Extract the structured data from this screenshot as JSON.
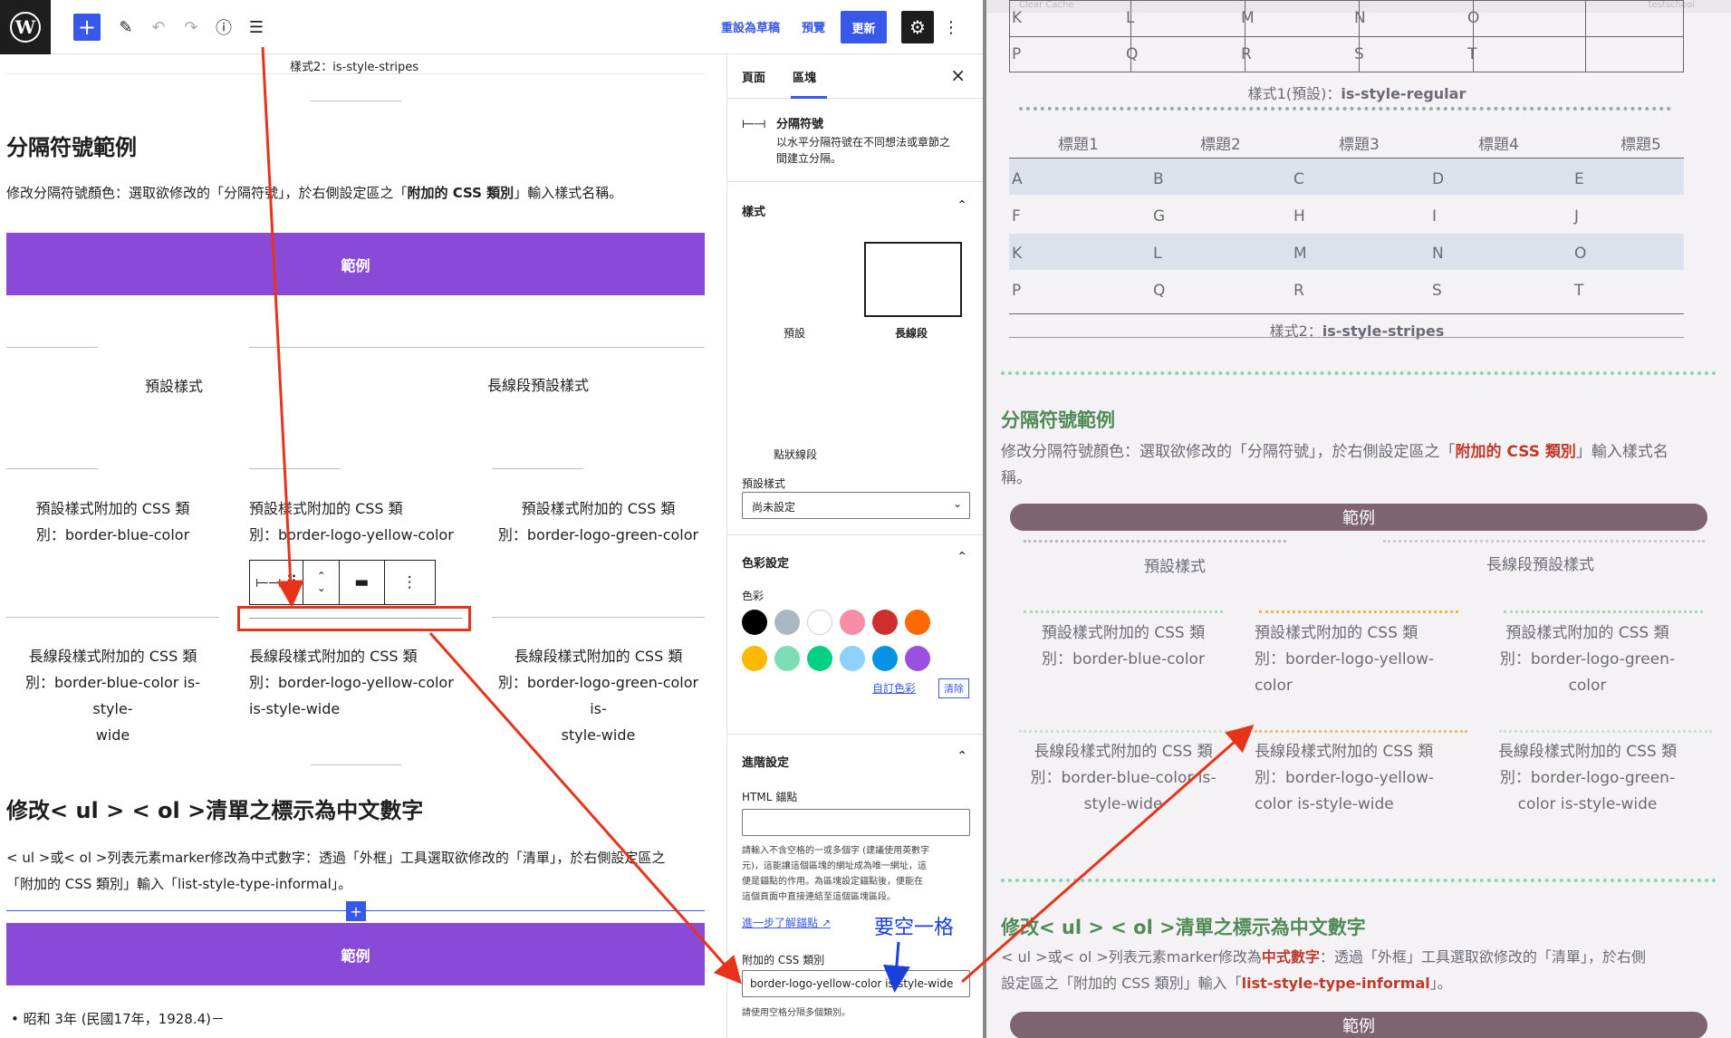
{
  "toolbar": {
    "revert_label": "重設為草稿",
    "preview_label": "預覽",
    "update_label": "更新",
    "logo_letter": "W"
  },
  "editor": {
    "caption_top": "樣式2：is-style-stripes",
    "heading1": "分隔符號範例",
    "para1_a": "修改分隔符號顏色：選取欲修改的「分隔符號」，於右側設定區之「",
    "para1_b": "附加的 CSS 類別",
    "para1_c": "」輸入樣式名稱。",
    "button1": "範例",
    "col_default": "預設樣式",
    "col_wide": "長線段預設樣式",
    "r1c1": [
      "預設樣式附加的 CSS 類",
      "別：border-blue-color"
    ],
    "r1c2": [
      "預設樣式附加的 CSS 類",
      "別：border-logo-yellow-color"
    ],
    "r1c3": [
      "預設樣式附加的 CSS 類",
      "別：border-logo-green-color"
    ],
    "r2c1": [
      "長線段樣式附加的 CSS 類",
      "別：border-blue-color is-style-",
      "wide"
    ],
    "r2c2": [
      "長線段樣式附加的 CSS 類",
      "別：border-logo-yellow-color",
      "is-style-wide"
    ],
    "r2c3": [
      "長線段樣式附加的 CSS 類",
      "別：border-logo-green-color is-",
      "style-wide"
    ],
    "heading2": "修改< ul > < ol >清單之標示為中文數字",
    "para2_l1": "< ul >或< ol >列表元素marker修改為中式數字：透過「外框」工具選取欲修改的「清單」，於右側設定區之",
    "para2_l2": "「附加的 CSS 類別」輸入「list-style-type-informal」。",
    "button2": "範例",
    "list_item": "昭和 3年 (民國17年，1928.4)－"
  },
  "sidebar": {
    "tab_page": "頁面",
    "tab_block": "區塊",
    "close": "×",
    "block_name": "分隔符號",
    "block_desc_1": "以水平分隔符號在不同想法或章節之",
    "block_desc_2": "間建立分隔。",
    "styles_title": "樣式",
    "style_default": "預設",
    "style_wide": "長線段",
    "style_dots": "點狀線段",
    "default_style_label": "預設樣式",
    "default_style_value": "尚未設定",
    "color_title": "色彩設定",
    "color_label": "色彩",
    "custom_color": "自訂色彩",
    "clear": "清除",
    "colors": [
      "#000000",
      "#abb8c3",
      "#ffffff",
      "#f78da7",
      "#cf2e2e",
      "#ff6900",
      "#fcb900",
      "#7bdcb5",
      "#00d084",
      "#8ed1fc",
      "#0693e3",
      "#9b51e0"
    ],
    "advanced_title": "進階設定",
    "html_anchor": "HTML 錨點",
    "anchor_help": [
      "請輸入不含空格的一或多個字 (建議使用英數字",
      "元)，這能讓這個區塊的網址成為唯一網址，這",
      "便是錨點的作用。為區塊設定錨點後，便能在",
      "這個頁面中直接連結至這個區塊區段。"
    ],
    "learn_more": "進一步了解錨點",
    "css_class_label": "附加的 CSS 類別",
    "css_class_value": "border-logo-yellow-color is-style-wide",
    "css_class_help": "請使用空格分隔多個類別。"
  },
  "annotation": {
    "space_note": "要空一格"
  },
  "front": {
    "admin_bar": "Clear Cache",
    "admin_right": "testschool",
    "table1_rows": [
      [
        "K",
        "L",
        "M",
        "N",
        "O"
      ],
      [
        "P",
        "Q",
        "R",
        "S",
        "T"
      ]
    ],
    "caption1_a": "樣式1(預設)：",
    "caption1_b": "is-style-regular",
    "table2_headers": [
      "標題1",
      "標題2",
      "標題3",
      "標題4",
      "標題5"
    ],
    "table2_rows": [
      [
        "A",
        "B",
        "C",
        "D",
        "E"
      ],
      [
        "F",
        "G",
        "H",
        "I",
        "J"
      ],
      [
        "K",
        "L",
        "M",
        "N",
        "O"
      ],
      [
        "P",
        "Q",
        "R",
        "S",
        "T"
      ]
    ],
    "caption2_a": "樣式2：",
    "caption2_b": "is-style-stripes",
    "heading1": "分隔符號範例",
    "para1_a": "修改分隔符號顏色：選取欲修改的「分隔符號」，於右側設定區之「",
    "para1_b": "附加的 CSS 類別",
    "para1_c": "」輸入樣式名",
    "para1_d": "稱。",
    "button1": "範例",
    "col_default": "預設樣式",
    "col_wide": "長線段預設樣式",
    "r1c1": [
      "預設樣式附加的 CSS 類",
      "別：border-blue-color"
    ],
    "r1c2": [
      "預設樣式附加的 CSS 類",
      "別：border-logo-yellow-",
      "color"
    ],
    "r1c3": [
      "預設樣式附加的 CSS 類",
      "別：border-logo-green-",
      "color"
    ],
    "r2c1": [
      "長線段樣式附加的 CSS 類",
      "別：border-blue-color is-",
      "style-wide"
    ],
    "r2c2": [
      "長線段樣式附加的 CSS 類",
      "別：border-logo-yellow-",
      "color is-style-wide"
    ],
    "r2c3": [
      "長線段樣式附加的 CSS 類",
      "別：border-logo-green-",
      "color is-style-wide"
    ],
    "heading2": "修改< ul > < ol >清單之標示為中文數字",
    "para2_a": "< ul >或< ol >列表元素marker修改為",
    "para2_b": "中式數字",
    "para2_c": "：透過「外框」工具選取欲修改的「清單」，於右側",
    "para2_d": "設定區之「附加的 CSS 類別」輸入「",
    "para2_e": "list-style-type-informal",
    "para2_f": "」。",
    "button2": "範例"
  }
}
